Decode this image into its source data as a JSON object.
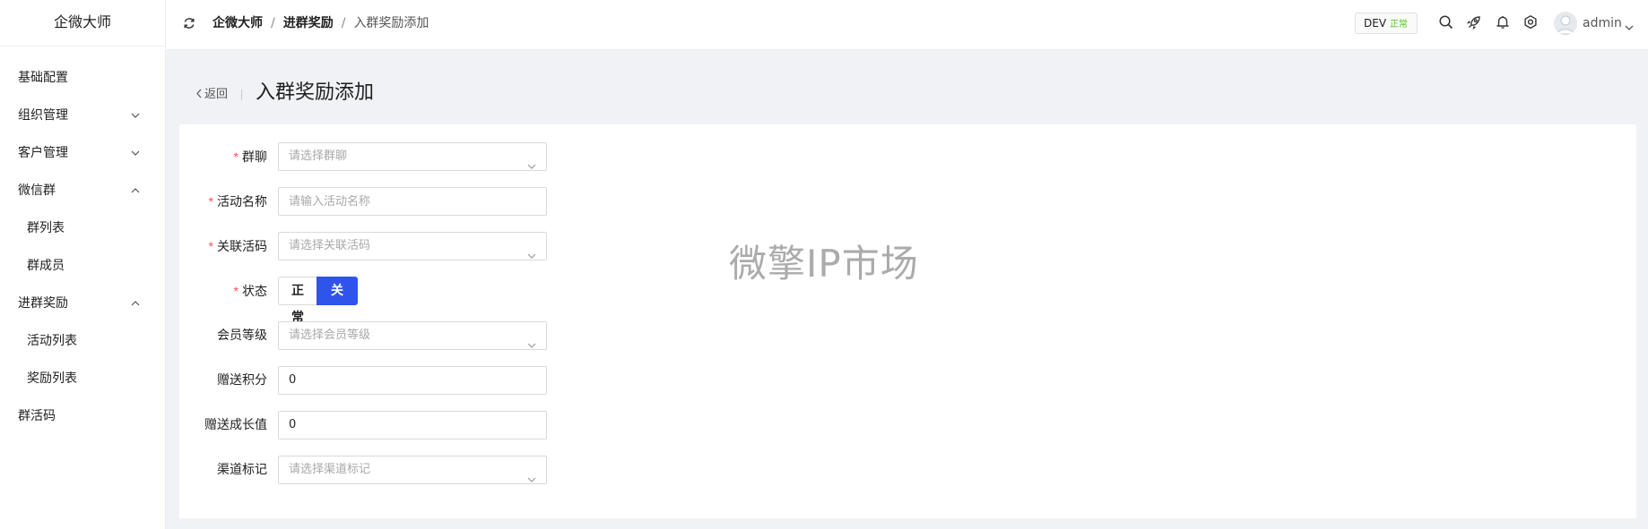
{
  "sidebar": {
    "logo": "企微大师",
    "items": [
      {
        "label": "基础配置"
      },
      {
        "label": "组织管理"
      },
      {
        "label": "客户管理"
      },
      {
        "label": "微信群"
      },
      {
        "label": "群列表"
      },
      {
        "label": "群成员"
      },
      {
        "label": "进群奖励"
      },
      {
        "label": "活动列表"
      },
      {
        "label": "奖励列表"
      },
      {
        "label": "群活码"
      }
    ]
  },
  "header": {
    "breadcrumb": [
      "企微大师",
      "进群奖励",
      "入群奖励添加"
    ],
    "env": {
      "name": "DEV",
      "status": "正常",
      "status_color": "#52c41a"
    },
    "user": "admin",
    "icons": [
      "refresh-icon",
      "search-icon",
      "rocket-icon",
      "bell-icon",
      "gear-icon",
      "avatar",
      "chevron-down-icon"
    ]
  },
  "page": {
    "back_label": "返回",
    "title": "入群奖励添加"
  },
  "form": {
    "group_chat": {
      "label": "群聊",
      "placeholder": "请选择群聊"
    },
    "activity_name": {
      "label": "活动名称",
      "placeholder": "请输入活动名称"
    },
    "linked_code": {
      "label": "关联活码",
      "placeholder": "请选择关联活码"
    },
    "status": {
      "label": "状态",
      "options": [
        "正常",
        "关闭"
      ],
      "selected": "关闭"
    },
    "member_level": {
      "label": "会员等级",
      "placeholder": "请选择会员等级"
    },
    "bonus_points": {
      "label": "赠送积分",
      "value": "0"
    },
    "growth_value": {
      "label": "赠送成长值",
      "value": "0"
    },
    "channel_tag": {
      "label": "渠道标记",
      "placeholder": "请选择渠道标记"
    }
  },
  "watermark": "微擎IP市场",
  "colors": {
    "accent": "#2f54eb",
    "required": "#ff4d4f",
    "background": "#f0f2f5"
  }
}
